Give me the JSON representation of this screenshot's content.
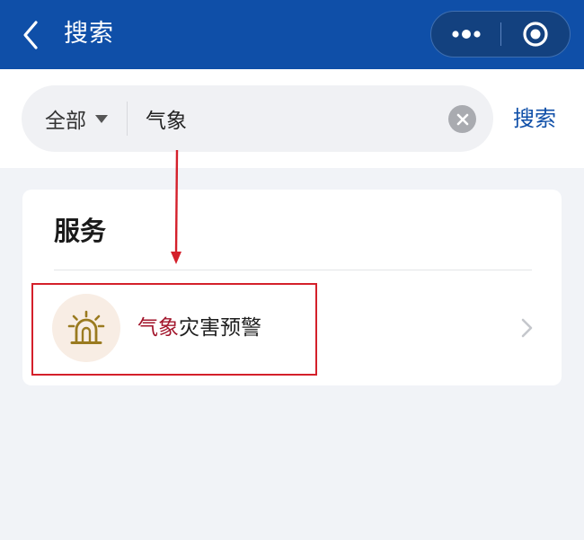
{
  "nav": {
    "title": "搜索",
    "back_icon": "chevron-left-icon",
    "more_icon": "more-dots-icon",
    "close_icon": "target-circle-icon",
    "background": "#0f4fa8"
  },
  "search": {
    "scope_label": "全部",
    "scope_icon": "caret-down-icon",
    "query": "气象",
    "clear_icon": "clear-x-icon",
    "submit_label": "搜索",
    "accent": "#0f4fa8"
  },
  "services": {
    "title": "服务",
    "results": [
      {
        "highlight": "气象",
        "rest": "灾害预警",
        "icon": "alarm-beacon-icon",
        "highlight_color": "#a2152b",
        "chevron_icon": "chevron-right-icon"
      }
    ]
  },
  "annotation": {
    "color": "#d4202b"
  }
}
